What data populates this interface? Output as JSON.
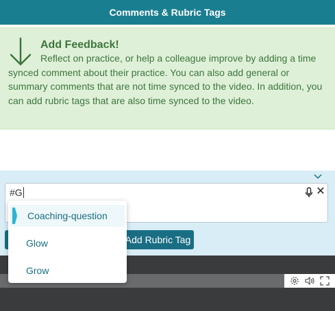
{
  "header": {
    "title": "Comments & Rubric Tags"
  },
  "feedback": {
    "title": "Add Feedback!",
    "body": "Reflect on practice, or help a colleague improve by adding a time synced comment about their practice. You can also add general or summary comments that are not time synced to the video. In addition, you can add rubric tags that are also time synced to the video."
  },
  "comment_input": {
    "value": "#G"
  },
  "buttons": {
    "add_rubric_tag": "Add Rubric Tag"
  },
  "dropdown": {
    "items": [
      {
        "label": "Coaching-question",
        "active": true
      },
      {
        "label": "Glow",
        "active": false
      },
      {
        "label": "Grow",
        "active": false
      }
    ]
  },
  "colors": {
    "header": "#1a7e91",
    "feedback_bg": "#dff0d8",
    "feedback_text": "#3c763d",
    "panel_bg": "#d9edf7",
    "button": "#1a6e84",
    "active_marker": "#2bb4d4"
  },
  "icons": [
    "arrow-down-icon",
    "chevron-down-icon",
    "microphone-icon",
    "close-icon",
    "settings-icon",
    "volume-icon",
    "fullscreen-icon"
  ]
}
